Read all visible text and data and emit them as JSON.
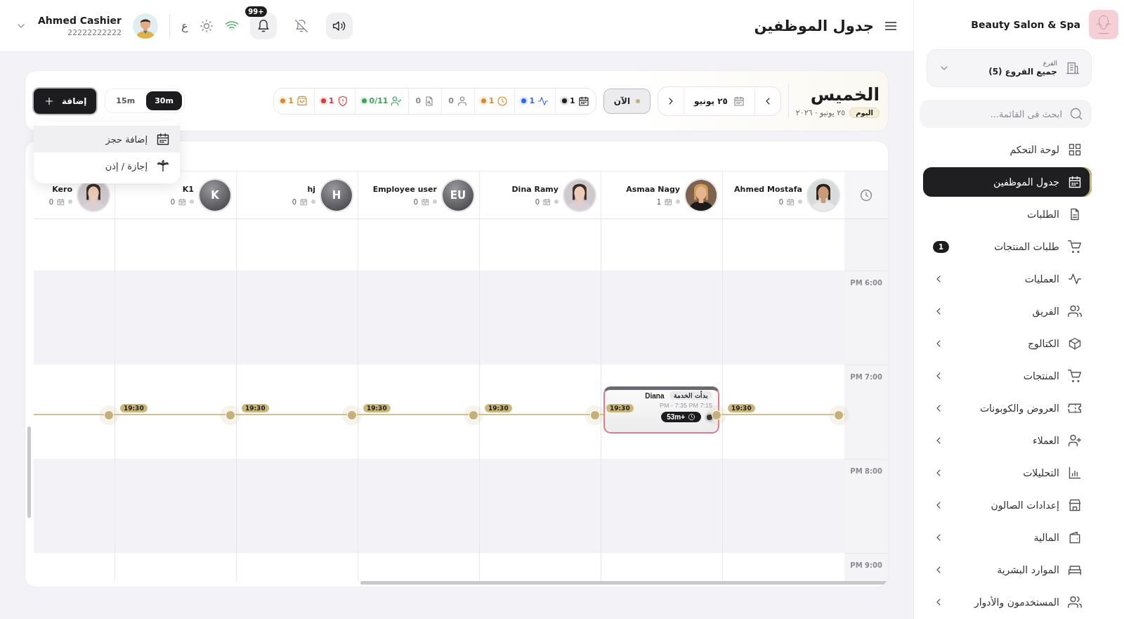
{
  "header": {
    "title": "جدول الموظفين",
    "user": {
      "name": "Ahmed Cashier",
      "phone": "22222222222"
    },
    "language": "ع",
    "notification_count": "+99"
  },
  "toolbar": {
    "day": "الخميس",
    "today_badge": "اليوم",
    "date": "٢٥ يونيو · ٢٠٢٦",
    "date_picker": "٢٥ يونيو",
    "now_button": "الآن",
    "stats": [
      {
        "kind": "bookings",
        "value": "1",
        "color": "#1f1f22"
      },
      {
        "kind": "active",
        "value": "1",
        "color": "#3567f0"
      },
      {
        "kind": "pending",
        "value": "1",
        "color": "#dd8a2e"
      },
      {
        "kind": "clients",
        "value": "0"
      },
      {
        "kind": "requests",
        "value": "0"
      },
      {
        "kind": "attendance",
        "value": "0/11",
        "color": "#3fa55b"
      },
      {
        "kind": "alerts",
        "value": "1",
        "color": "#de3a3a"
      },
      {
        "kind": "orders",
        "value": "1",
        "color": "#dd8a2e"
      }
    ],
    "intervals": [
      {
        "label": "30m",
        "selected": true
      },
      {
        "label": "15m",
        "selected": false
      }
    ],
    "add_button": "إضافة",
    "add_menu": [
      {
        "kind": "booking",
        "label": "إضافة حجز",
        "selected": true
      },
      {
        "kind": "leave",
        "label": "إجازة / إذن",
        "selected": false
      }
    ]
  },
  "schedule": {
    "employees": [
      {
        "name": "Ahmed Mostafa",
        "count": "0",
        "avatar": {
          "kind": "picture"
        },
        "now_label": "19:30"
      },
      {
        "name": "Asmaa Nagy",
        "count": "1",
        "avatar": {
          "kind": "picture"
        },
        "now_label": "19:30",
        "appointments": [
          {
            "client": "Diana",
            "status": "بدأت الخدمة",
            "time": "PM - 7:35 PM 7:15",
            "overtime": "53m+"
          }
        ]
      },
      {
        "name": "Dina Ramy",
        "count": "0",
        "avatar": {
          "kind": "picture"
        },
        "now_label": "19:30"
      },
      {
        "name": "Employee user",
        "count": "0",
        "avatar": {
          "kind": "initials",
          "text": "EU"
        },
        "now_label": "19:30"
      },
      {
        "name": "hj",
        "count": "0",
        "avatar": {
          "kind": "initials",
          "text": "H"
        },
        "now_label": "19:30"
      },
      {
        "name": "K1",
        "count": "0",
        "avatar": {
          "kind": "initials",
          "text": "K"
        },
        "now_label": "19:30"
      },
      {
        "name": "Kero",
        "count": "0",
        "avatar": {
          "kind": "picture"
        }
      }
    ],
    "time_labels": [
      "PM 6:00",
      "PM 7:00",
      "PM 8:00",
      "PM 9:00"
    ]
  },
  "sidebar": {
    "brand": "Beauty Salon & Spa",
    "branch": {
      "label": "الفرع",
      "value": "جميع الفروع (5)"
    },
    "search": {
      "placeholder": "ابحث فى القائمة..."
    },
    "items": [
      {
        "kind": "dashboard",
        "label": "لوحة التحكم",
        "selected": false,
        "expandable": false
      },
      {
        "kind": "schedule",
        "label": "جدول الموظفين",
        "selected": true,
        "expandable": false
      },
      {
        "kind": "orders",
        "label": "الطلبات",
        "selected": false,
        "expandable": false
      },
      {
        "kind": "product_orders",
        "label": "طلبات المنتجات",
        "selected": false,
        "expandable": false,
        "badge": "1"
      },
      {
        "kind": "operations",
        "label": "العمليات",
        "selected": false,
        "expandable": true
      },
      {
        "kind": "team",
        "label": "الفريق",
        "selected": false,
        "expandable": true
      },
      {
        "kind": "catalog",
        "label": "الكتالوج",
        "selected": false,
        "expandable": true
      },
      {
        "kind": "products",
        "label": "المنتجات",
        "selected": false,
        "expandable": true
      },
      {
        "kind": "offers",
        "label": "العروض والكوبونات",
        "selected": false,
        "expandable": true
      },
      {
        "kind": "customers",
        "label": "العملاء",
        "selected": false,
        "expandable": true
      },
      {
        "kind": "analytics",
        "label": "التحليلات",
        "selected": false,
        "expandable": true
      },
      {
        "kind": "settings",
        "label": "إعدادات الصالون",
        "selected": false,
        "expandable": true
      },
      {
        "kind": "finance",
        "label": "المالية",
        "selected": false,
        "expandable": true
      },
      {
        "kind": "hr",
        "label": "الموارد البشرية",
        "selected": false,
        "expandable": true
      },
      {
        "kind": "users",
        "label": "المستخدمون والأدوار",
        "selected": false,
        "expandable": true
      }
    ]
  }
}
